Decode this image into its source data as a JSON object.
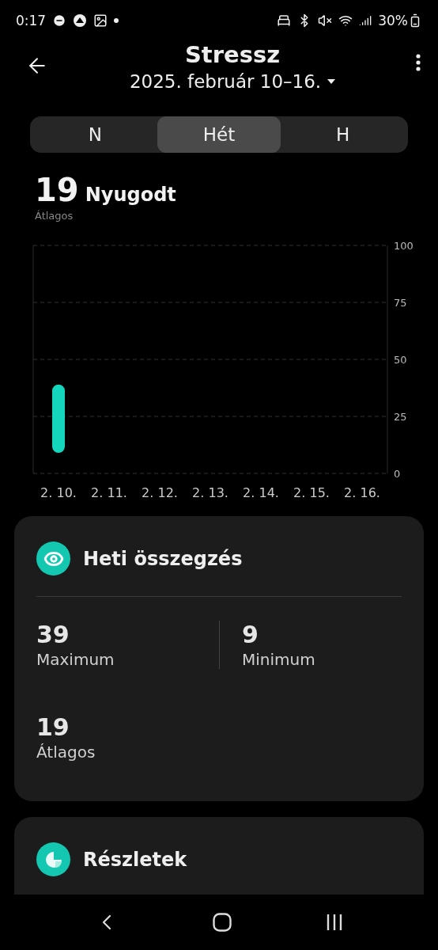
{
  "status_bar": {
    "time": "0:17",
    "battery": "30%"
  },
  "header": {
    "title": "Stressz",
    "date_range": "2025. február 10–16."
  },
  "tabs": [
    {
      "label": "N",
      "selected": false
    },
    {
      "label": "Hét",
      "selected": true
    },
    {
      "label": "H",
      "selected": false
    }
  ],
  "summary": {
    "value": "19",
    "status": "Nyugodt",
    "caption": "Átlagos"
  },
  "chart": {
    "chart_data": {
      "type": "candlestick",
      "categories": [
        "2. 10.",
        "2. 11.",
        "2. 12.",
        "2. 13.",
        "2. 14.",
        "2. 15.",
        "2. 16."
      ],
      "ohlc": [
        [
          9,
          39,
          9,
          39
        ],
        null,
        null,
        null,
        null,
        null,
        null
      ],
      "ylim": [
        0,
        100
      ],
      "yticks": [
        0,
        25,
        50,
        75,
        100
      ],
      "grid": true
    }
  },
  "cards": [
    {
      "kind": "stats",
      "title": "Heti összegzés",
      "stats": [
        {
          "value": "39",
          "label": "Maximum"
        },
        {
          "value": "9",
          "label": "Minimum"
        },
        {
          "value": "19",
          "label": "Átlagos"
        }
      ]
    },
    {
      "kind": "details",
      "title": "Részletek"
    }
  ]
}
